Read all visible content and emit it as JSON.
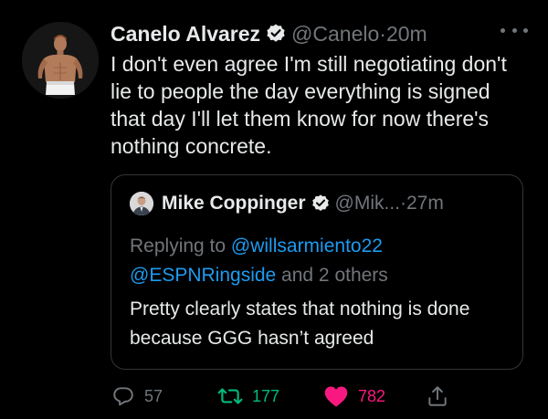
{
  "tweet": {
    "display_name": "Canelo Alvarez",
    "handle": "@Canelo",
    "separator": "·",
    "time": "20m",
    "text": "I don't even agree I'm still negotiating don't lie to people the day everything is signed that day I'll let them know for now there's nothing concrete."
  },
  "quoted": {
    "display_name": "Mike Coppinger",
    "handle": "@Mik...",
    "separator": "·",
    "time": "27m",
    "replying_prefix": "Replying to ",
    "mention_1": "@willsarmiento22",
    "mention_2": "@ESPNRingside",
    "replying_suffix": " and 2 others",
    "text": "Pretty clearly states that nothing is done because GGG hasn’t agreed"
  },
  "actions": {
    "replies": "57",
    "retweets": "177",
    "likes": "782"
  },
  "icons": {
    "verified": "verified-badge-icon",
    "more": "more-horizontal-icon",
    "reply": "reply-icon",
    "retweet": "retweet-icon",
    "like": "heart-filled-icon",
    "share": "share-icon"
  },
  "colors": {
    "background": "#000000",
    "text": "#e7e9ea",
    "muted": "#71767b",
    "link": "#1d9bf0",
    "retweet": "#00ba7c",
    "like": "#f91880",
    "border": "#333639"
  }
}
